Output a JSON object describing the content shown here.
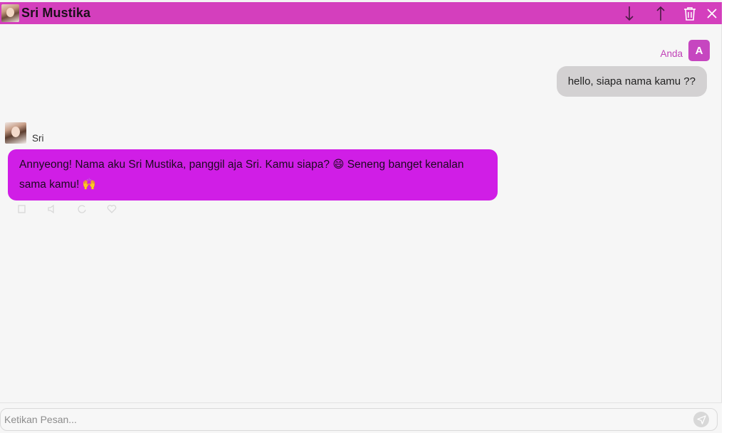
{
  "header": {
    "title": "Sri Mustika",
    "avatar_icon": "character-portrait-icon",
    "actions": [
      "scroll-down-icon",
      "scroll-up-icon",
      "trash-icon",
      "close-icon"
    ],
    "color": "#d43fbd"
  },
  "messages": {
    "user": {
      "name": "Anda",
      "avatar_letter": "A",
      "text": "hello, siapa nama kamu ??"
    },
    "bot": {
      "name": "Sri",
      "text": "Annyeong! Nama aku Sri Mustika, panggil aja Sri. Kamu siapa? 😄 Seneng banget kenalan sama kamu! 🙌",
      "bubble_color": "#d01ee6"
    }
  },
  "composer": {
    "placeholder": "Ketikan Pesan...",
    "send_icon": "send-icon"
  }
}
